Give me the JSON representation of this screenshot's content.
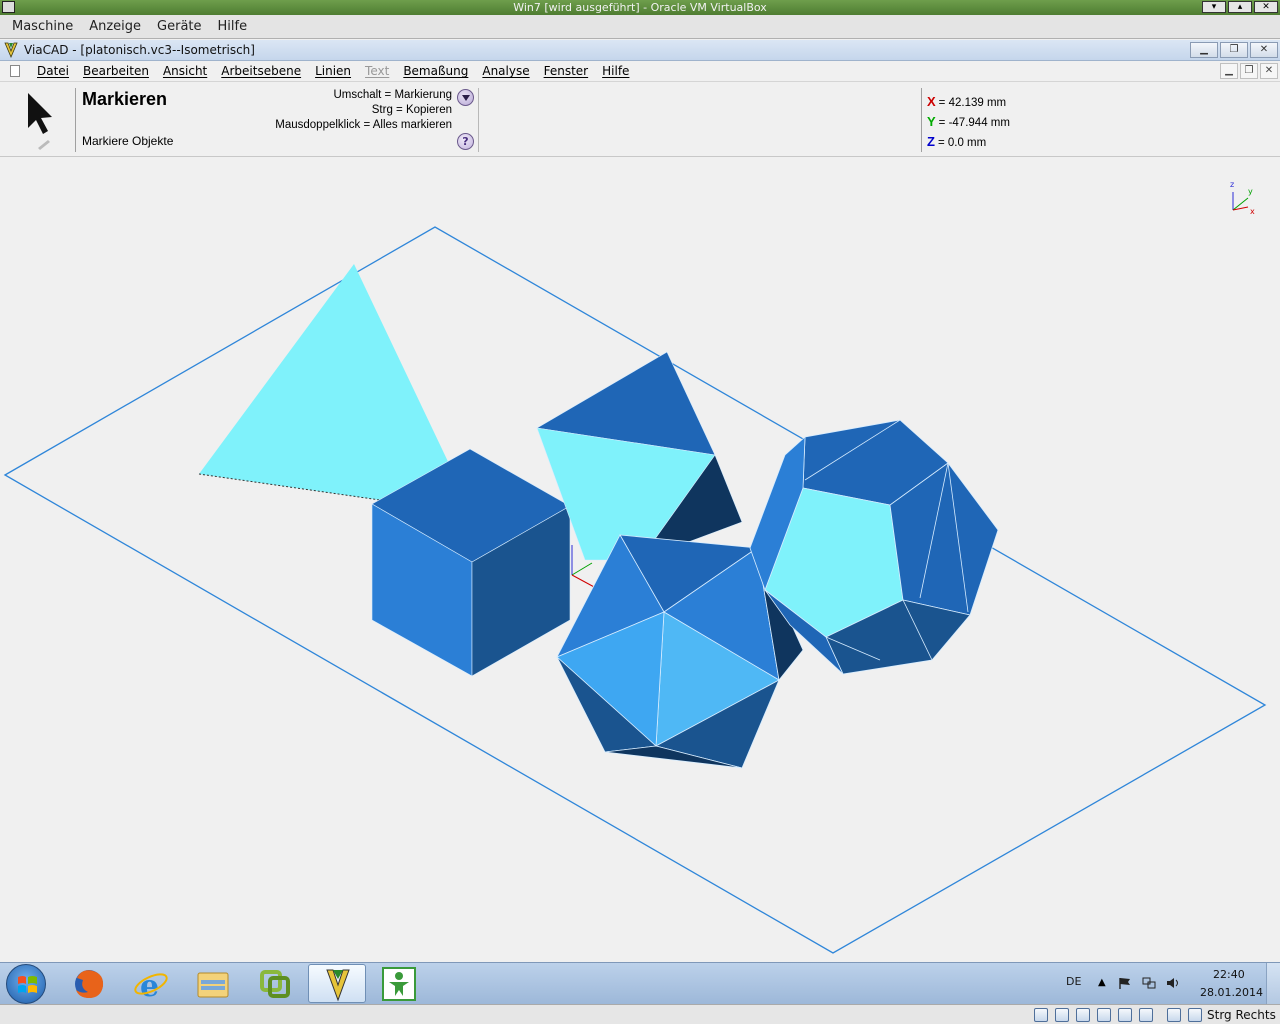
{
  "host": {
    "title": "Win7 [wird ausgeführt] - Oracle VM VirtualBox",
    "menu": [
      "Maschine",
      "Anzeige",
      "Geräte",
      "Hilfe"
    ],
    "host_key_label": "Strg Rechts"
  },
  "app": {
    "title": "ViaCAD - [platonisch.vc3--Isometrisch]",
    "menu": [
      {
        "label": "Datei",
        "enabled": true
      },
      {
        "label": "Bearbeiten",
        "enabled": true
      },
      {
        "label": "Ansicht",
        "enabled": true
      },
      {
        "label": "Arbeitsebene",
        "enabled": true
      },
      {
        "label": "Linien",
        "enabled": true
      },
      {
        "label": "Text",
        "enabled": false
      },
      {
        "label": "Bemaßung",
        "enabled": true
      },
      {
        "label": "Analyse",
        "enabled": true
      },
      {
        "label": "Fenster",
        "enabled": true
      },
      {
        "label": "Hilfe",
        "enabled": true
      }
    ]
  },
  "tool": {
    "name": "Markieren",
    "description": "Markiere Objekte",
    "hints": [
      "Umschalt = Markierung",
      "Strg = Kopieren",
      "Mausdoppelklick = Alles markieren"
    ],
    "help_symbol": "?"
  },
  "coords": {
    "x_label": "X",
    "x_value": "= 42.139 mm",
    "y_label": "Y",
    "y_value": "= -47.944 mm",
    "z_label": "Z",
    "z_value": "= 0.0 mm",
    "x_color": "#cc0000",
    "y_color": "#00aa00",
    "z_color": "#0000cc"
  },
  "viewport": {
    "axis_labels": [
      "z",
      "y",
      "x"
    ],
    "workplane_color": "#2f86d9",
    "face_colors": [
      "#7ff2fb",
      "#2b7fd6",
      "#1f66b6",
      "#1a548f",
      "#0f355e",
      "#3ea7f2",
      "#4fb8f5"
    ]
  },
  "taskbar": {
    "language": "DE",
    "time": "22:40",
    "date": "28.01.2014"
  }
}
